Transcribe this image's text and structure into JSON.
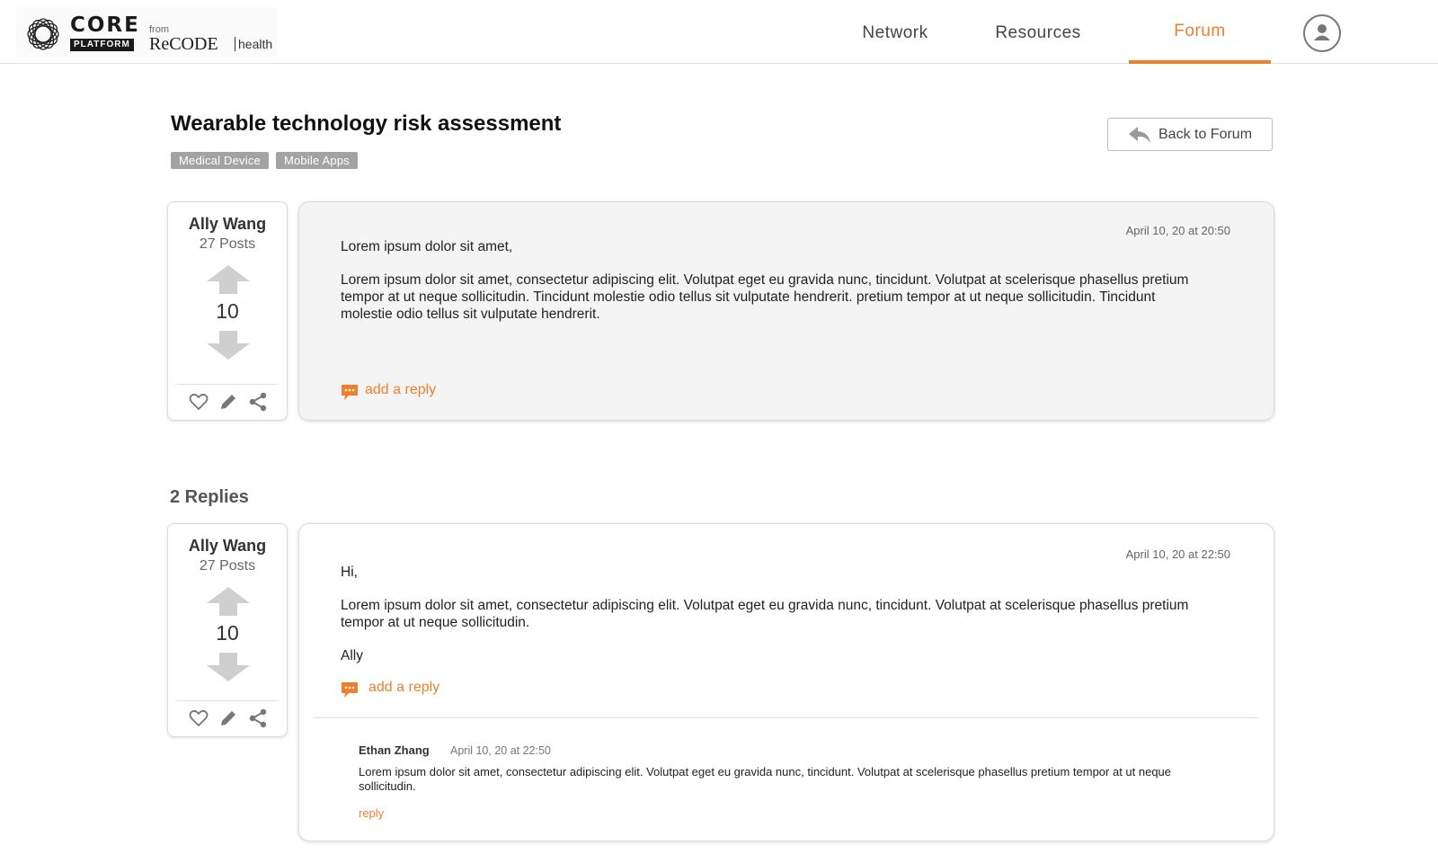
{
  "brand": {
    "core": "CORE",
    "platform": "PLATFORM",
    "from": "from",
    "recode": "ReCODE",
    "health": "health"
  },
  "nav": {
    "items": [
      {
        "label": "Network"
      },
      {
        "label": "Resources"
      },
      {
        "label": "Forum",
        "active": true
      }
    ],
    "profile_icon": "user-icon"
  },
  "colors": {
    "accent": "#f07f2c",
    "tag_bg": "#a3a3a3",
    "icon_gray": "#cfcfcf"
  },
  "thread": {
    "title": "Wearable technology risk assessment",
    "tags": [
      "Medical Device",
      "Mobile Apps"
    ],
    "back_button": "Back to Forum"
  },
  "main_post": {
    "author": {
      "name": "Ally Wang",
      "posts": "27 Posts",
      "votes": "10"
    },
    "date": "April 10, 20 at 20:50",
    "greeting": "Lorem ipsum dolor sit amet,",
    "body": "Lorem ipsum dolor sit amet, consectetur adipiscing elit. Volutpat eget eu gravida nunc, tincidunt. Volutpat at scelerisque phasellus pretium tempor at ut neque sollicitudin. Tincidunt molestie odio tellus sit vulputate hendrerit. pretium tempor at ut neque sollicitudin. Tincidunt molestie odio tellus sit vulputate hendrerit.",
    "add_reply": "add a reply"
  },
  "replies": {
    "count_label": "2 Replies",
    "items": [
      {
        "author": {
          "name": "Ally Wang",
          "posts": "27 Posts",
          "votes": "10"
        },
        "date": "April 10, 20 at 22:50",
        "greeting": "Hi,",
        "body": "Lorem ipsum dolor sit amet, consectetur adipiscing elit. Volutpat eget eu gravida nunc, tincidunt. Volutpat at scelerisque phasellus pretium tempor at ut neque sollicitudin.",
        "signoff": "Ally",
        "add_reply": "add a reply",
        "nested": {
          "name": "Ethan Zhang",
          "date": "April 10, 20 at 22:50",
          "text": "Lorem ipsum dolor sit amet, consectetur adipiscing elit. Volutpat eget eu gravida nunc, tincidunt. Volutpat at scelerisque phasellus pretium tempor at ut neque sollicitudin.",
          "reply": "reply"
        }
      }
    ]
  }
}
